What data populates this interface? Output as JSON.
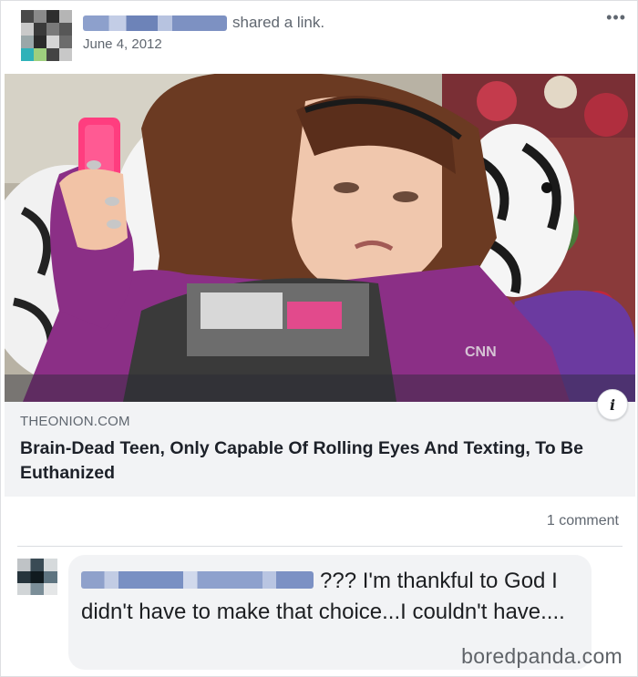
{
  "post": {
    "shared_text": "shared a link.",
    "date": "June 4, 2012",
    "more_label": "•••"
  },
  "link": {
    "domain": "THEONION.COM",
    "title": "Brain-Dead Teen, Only Capable Of Rolling Eyes And Texting, To Be Euthanized",
    "info_label": "i",
    "image_watermark": "CNN"
  },
  "comments": {
    "count_label": "1 comment",
    "items": [
      {
        "text": "??? I'm thankful to God I didn't have to make that choice...I couldn't have...."
      }
    ]
  },
  "watermark": "boredpanda.com",
  "colors": {
    "meta_gray": "#606770",
    "card_bg": "#f2f3f5",
    "blur_blue": "#7d91c2"
  }
}
